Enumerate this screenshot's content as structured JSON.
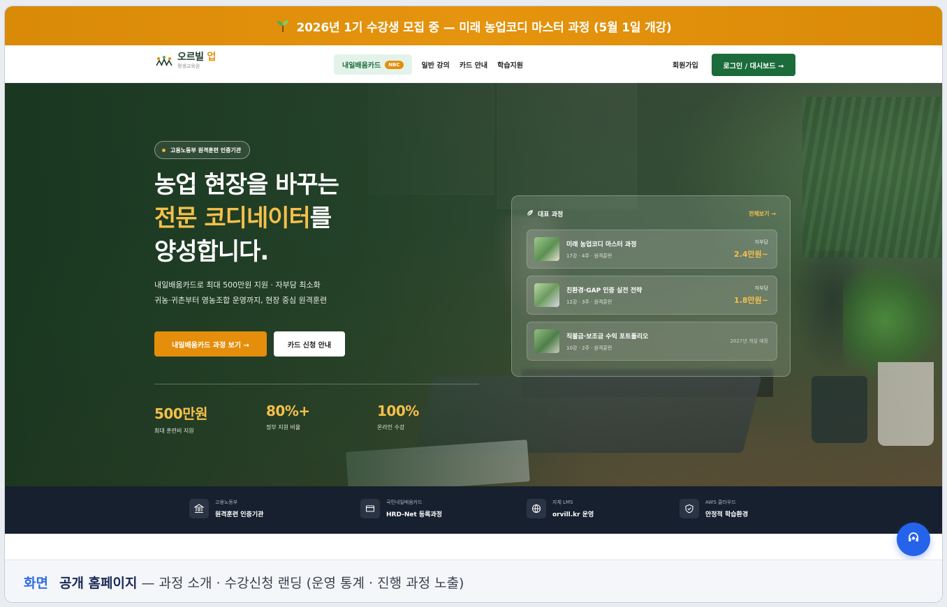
{
  "promo": {
    "icon": "sprout-icon",
    "text": "2026년 1기 수강생 모집 중 — 미래 농업코디 마스터 과정 (5월 1일 개강)"
  },
  "nav": {
    "logo_name": "오르빌",
    "logo_accent": "업",
    "logo_sub": "평생교육원",
    "menu": [
      {
        "label": "내일배움카드",
        "badge": "NBC",
        "active": true
      },
      {
        "label": "일반 강의"
      },
      {
        "label": "카드 안내"
      },
      {
        "label": "학습지원"
      }
    ],
    "signup": "회원가입",
    "login": "로그인 / 대시보드 →"
  },
  "hero": {
    "badge": "고용노동부 원격훈련 인증기관",
    "headline_line1": "농업 현장을 바꾸는",
    "headline_line2_highlight": "전문 코디네이터",
    "headline_line2_rest": "를",
    "headline_line3": "양성합니다.",
    "desc_line1": "내일배움카드로 최대 500만원 지원 · 자부담 최소화",
    "desc_line2": "귀농·귀촌부터 영농조합 운영까지, 현장 중심 원격훈련",
    "cta_primary": "내일배움카드 과정 보기 →",
    "cta_secondary": "카드 신청 안내",
    "stats": [
      {
        "value": "500만원",
        "label": "최대 훈련비 지원"
      },
      {
        "value": "80%+",
        "label": "정부 지원 비율"
      },
      {
        "value": "100%",
        "label": "온라인 수강"
      }
    ]
  },
  "courses": {
    "title": "대표 과정",
    "title_icon": "leaf-icon",
    "more": "전체보기 →",
    "items": [
      {
        "name": "미래 농업코디 마스터 과정",
        "meta": "17강 · 4주 · 원격훈련",
        "tag": "자부담",
        "price": "2.4만원~"
      },
      {
        "name": "친환경·GAP 인증 실전 전략",
        "meta": "12강 · 3주 · 원격훈련",
        "tag": "자부담",
        "price": "1.8만원~"
      },
      {
        "name": "직불금·보조금 수익 포트폴리오",
        "meta": "10강 · 2주 · 원격훈련",
        "note": "2027년 개설 예정"
      }
    ]
  },
  "trust": [
    {
      "icon": "bank-icon",
      "small": "고용노동부",
      "big": "원격훈련 인증기관"
    },
    {
      "icon": "card-icon",
      "small": "국민내일배움카드",
      "big": "HRD-Net 등록과정"
    },
    {
      "icon": "globe-icon",
      "small": "자체 LMS",
      "big": "orvill.kr 운영"
    },
    {
      "icon": "shield-icon",
      "small": "AWS 클라우드",
      "big": "안정적 학습환경"
    }
  ],
  "chat_icon": "support-chat-icon",
  "caption": {
    "key": "화면",
    "title": "공개 홈페이지",
    "desc": "— 과정 소개 · 수강신청 랜딩 (운영 통계 · 진행 과정 노출)"
  },
  "colors": {
    "promo": "#e5940e",
    "brand_green": "#1c6b3a",
    "accent_orange": "#e58e0b",
    "highlight_yellow": "#f5c04a",
    "trust_bg": "#17202e",
    "chat_blue": "#2563eb",
    "caption_key": "#2f6de1"
  }
}
